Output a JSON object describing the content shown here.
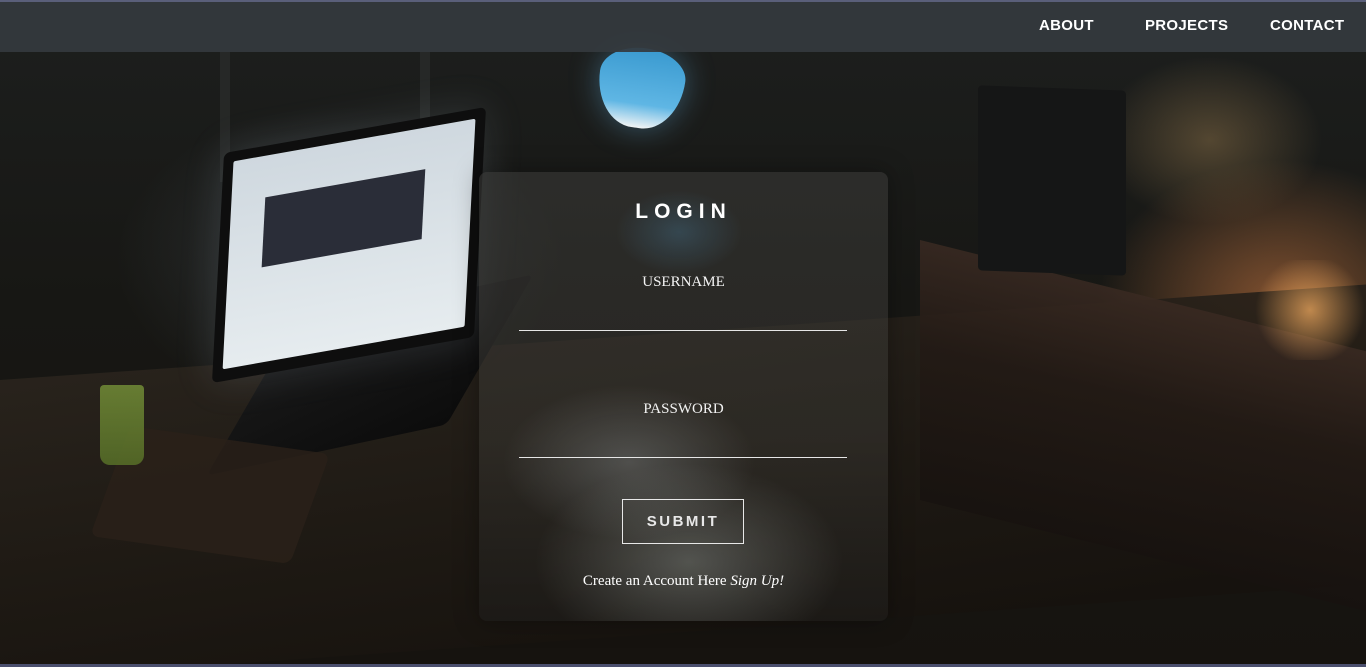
{
  "nav": {
    "items": [
      {
        "label": "ABOUT"
      },
      {
        "label": "PROJECTS"
      },
      {
        "label": "CONTACT"
      }
    ]
  },
  "login": {
    "title": "LOGIN",
    "username_label": "USERNAME",
    "username_value": "",
    "password_label": "PASSWORD",
    "password_value": "",
    "submit_label": "SUBMIT",
    "signup_prefix": "Create an Account Here",
    "signup_link": "Sign Up!"
  },
  "colors": {
    "navbar_bg": "#343a3e",
    "text": "#ffffff",
    "accent_line": "#5a5f7a"
  }
}
